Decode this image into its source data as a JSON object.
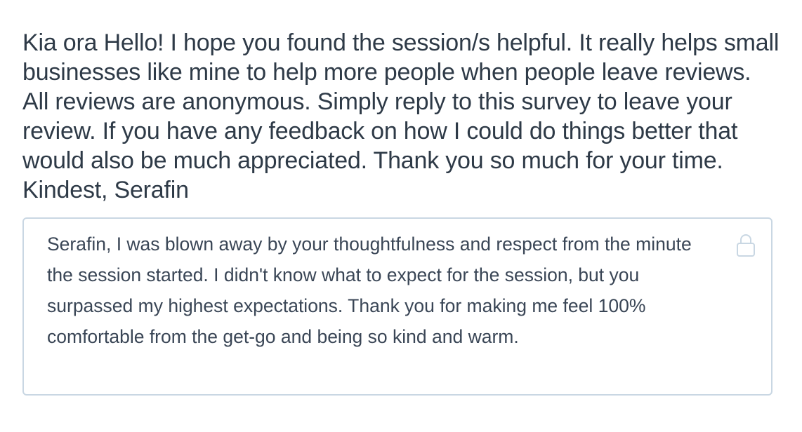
{
  "question": {
    "text": "Kia ora Hello! I hope you found the session/s helpful. It really helps small businesses like mine to help more people when people leave reviews. All reviews are anonymous. Simply reply to this survey to leave your review. If you have any feedback on how I could do things better that would also be much appreciated. Thank you so much for your time. Kindest, Serafin"
  },
  "answer": {
    "value": "Serafin, I was blown away by your thoughtfulness and respect from the minute the session started. I didn't know what to expect for the session, but you surpassed my highest expectations. Thank you for making me feel 100% comfortable from the get-go and being so kind and warm.",
    "icon": "lock-icon",
    "border_color": "#c9d7e3"
  }
}
